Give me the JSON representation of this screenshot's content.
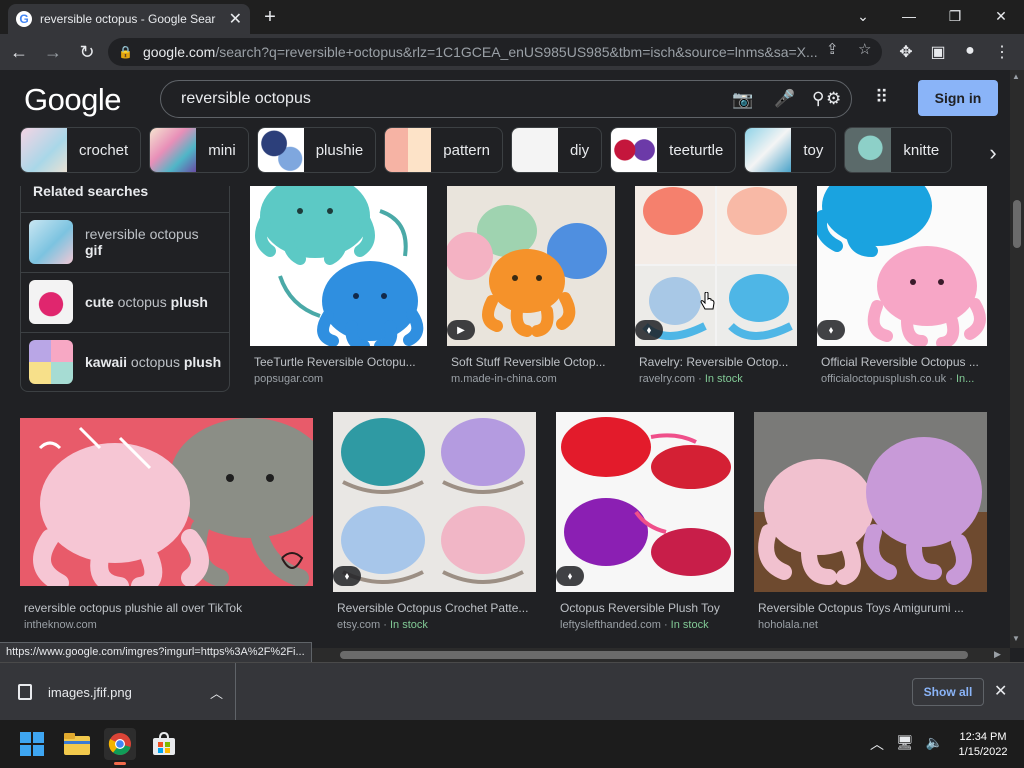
{
  "browser": {
    "tab_title": "reversible octopus - Google Sear",
    "url_host": "google.com",
    "url_rest": "/search?q=reversible+octopus&rlz=1C1GCEA_enUS985US985&tbm=isch&source=lnms&sa=X..."
  },
  "google": {
    "logo": "Google",
    "query": "reversible octopus",
    "signin_label": "Sign in",
    "chips": [
      {
        "label": "crochet"
      },
      {
        "label": "mini"
      },
      {
        "label": "plushie"
      },
      {
        "label": "pattern"
      },
      {
        "label": "diy"
      },
      {
        "label": "teeturtle"
      },
      {
        "label": "toy"
      },
      {
        "label": "knitte"
      }
    ]
  },
  "related": {
    "title": "Related searches",
    "items": [
      {
        "pre": "reversible octopus ",
        "bold": "gif",
        "post": ""
      },
      {
        "pre": "",
        "bold": "cute",
        "post": " octopus ",
        "bold2": "plush"
      },
      {
        "pre": "",
        "bold": "kawaii",
        "post": " octopus ",
        "bold2": "plush"
      }
    ]
  },
  "results": [
    {
      "caption": "TeeTurtle Reversible Octopu...",
      "source": "popsugar.com",
      "stock": ""
    },
    {
      "caption": "Soft Stuff Reversible Octop...",
      "source": "m.made-in-china.com",
      "stock": ""
    },
    {
      "caption": "Ravelry: Reversible Octop...",
      "source": "ravelry.com",
      "stock": "In stock"
    },
    {
      "caption": "Official Reversible Octopus ...",
      "source": "officialoctopusplush.co.uk",
      "stock": "In..."
    },
    {
      "caption": "reversible octopus plushie all over TikTok",
      "source": "intheknow.com",
      "stock": ""
    },
    {
      "caption": "Reversible Octopus Crochet Patte...",
      "source": "etsy.com",
      "stock": "In stock"
    },
    {
      "caption": "Octopus Reversible Plush Toy",
      "source": "leftyslefthanded.com",
      "stock": "In stock"
    },
    {
      "caption": "Reversible Octopus Toys Amigurumi ...",
      "source": "hoholala.net",
      "stock": ""
    }
  ],
  "status_url": "https://www.google.com/imgres?imgurl=https%3A%2F%2Fi...",
  "downloads": {
    "file": "images.jfif.png",
    "show_all": "Show all"
  },
  "taskbar": {
    "time": "12:34 PM",
    "date": "1/15/2022"
  },
  "colors": {
    "accent": "#8ab4f8",
    "in_stock": "#81c995",
    "background": "#202124"
  }
}
